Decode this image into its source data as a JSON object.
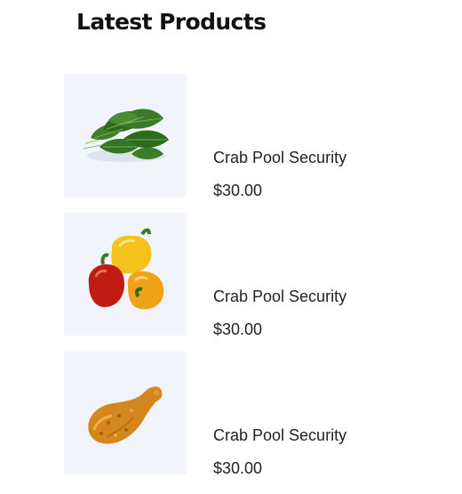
{
  "widget": {
    "title": "Latest Products"
  },
  "products": [
    {
      "name": "Crab Pool Security",
      "price": "$30.00",
      "image_icon": "spinach-icon"
    },
    {
      "name": "Crab Pool Security",
      "price": "$30.00",
      "image_icon": "bell-peppers-icon"
    },
    {
      "name": "Crab Pool Security",
      "price": "$30.00",
      "image_icon": "fried-chicken-icon"
    }
  ],
  "colors": {
    "thumb_background": "#f1f4fa",
    "text": "#222222"
  }
}
